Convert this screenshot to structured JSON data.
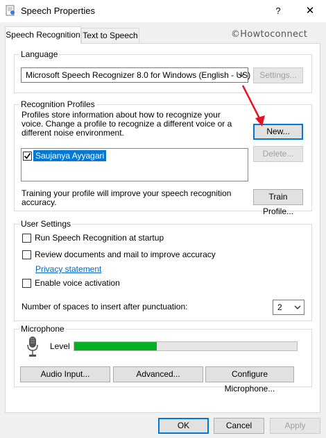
{
  "window": {
    "title": "Speech Properties",
    "help_label": "?",
    "close_label": "✕",
    "icon": "speech-properties-app-icon"
  },
  "tabs": [
    {
      "label": "Speech Recognition",
      "active": true
    },
    {
      "label": "Text to Speech",
      "active": false
    }
  ],
  "watermark": "©Howtoconnect",
  "language": {
    "group_label": "Language",
    "selected": "Microsoft Speech Recognizer 8.0 for Windows (English - US)",
    "settings_label": "Settings..."
  },
  "profiles": {
    "group_label": "Recognition Profiles",
    "description": "Profiles store information about how to recognize your voice. Change a profile to recognize a different voice or a different noise environment.",
    "new_label": "New...",
    "delete_label": "Delete...",
    "items": [
      {
        "name": "Saujanya Ayyagari",
        "checked": true,
        "selected": true
      }
    ],
    "training_text": "Training your profile will improve your speech recognition accuracy.",
    "train_label": "Train Profile..."
  },
  "user_settings": {
    "group_label": "User Settings",
    "run_at_startup": {
      "label": "Run Speech Recognition at startup",
      "checked": false
    },
    "review_docs": {
      "label": "Review documents and mail to improve accuracy",
      "checked": false
    },
    "privacy_link": "Privacy statement",
    "voice_activation": {
      "label": "Enable voice activation",
      "checked": false
    },
    "spaces_label": "Number of spaces to insert after punctuation:",
    "spaces_value": "2"
  },
  "microphone": {
    "group_label": "Microphone",
    "level_label": "Level",
    "level_fraction": 0.37,
    "level_color": "#06b025",
    "audio_input_label": "Audio Input...",
    "advanced_label": "Advanced...",
    "configure_label": "Configure Microphone..."
  },
  "footer": {
    "ok_label": "OK",
    "cancel_label": "Cancel",
    "apply_label": "Apply"
  },
  "annotation": {
    "type": "red-arrow",
    "color": "#e81123",
    "points_to": "new-profile-button"
  }
}
